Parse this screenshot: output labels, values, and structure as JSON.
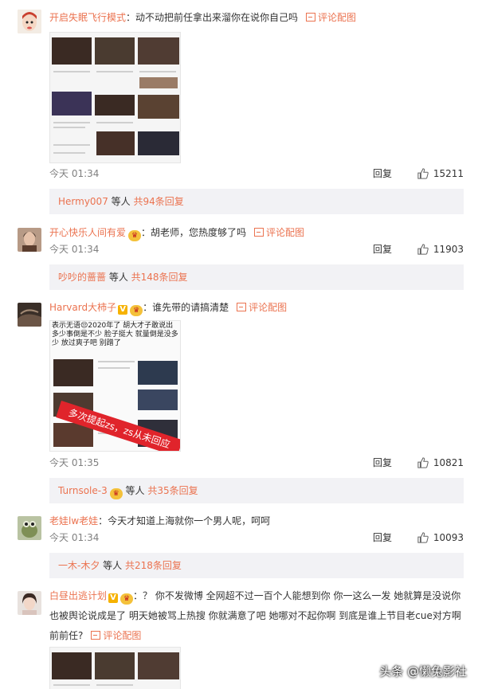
{
  "comments": [
    {
      "user": "开启失眠飞行模式",
      "text": "：动不动把前任拿出来溜你在说你自己吗",
      "pic_label": "评论配图",
      "time": "今天 01:34",
      "reply_label": "回复",
      "likes": "15211",
      "replies": {
        "user": "Hermy007",
        "middle": " 等人 ",
        "count": "共94条回复"
      }
    },
    {
      "user": "开心快乐人间有爱",
      "text": "：胡老师，您热度够了吗",
      "pic_label": "评论配图",
      "time": "今天 01:34",
      "reply_label": "回复",
      "likes": "11903",
      "replies": {
        "user": "吵吵的蔷蔷",
        "middle": " 等人 ",
        "count": "共148条回复"
      }
    },
    {
      "user": "Harvard大柿子",
      "text": "：谁先带的请搞清楚",
      "pic_label": "评论配图",
      "time": "今天 01:35",
      "reply_label": "回复",
      "likes": "10821",
      "image_text_top": "表示无语😒2020年了 胡大才子敢说出多少事倒是不少 脸子挺大 就量倒是没多少 放过爽子吧 别蹭了",
      "image_banner": "多次提起zs，zs从未回应",
      "replies": {
        "user": "Turnsole-3",
        "middle": " 等人 ",
        "count": "共35条回复"
      }
    },
    {
      "user": "老娃lw老娃",
      "text": "：今天才知道上海就你一个男人呢，呵呵",
      "time": "今天 01:34",
      "reply_label": "回复",
      "likes": "10093",
      "replies": {
        "user": "一木-木夕",
        "middle": " 等人 ",
        "count": "共218条回复"
      }
    },
    {
      "user": "白昼出逃计划",
      "text_line1": "：？ 你不发微博 全网超不过一百个人能想到你 你一这么一发 她就算是没说你",
      "text_line2": "也被舆论说成是了 明天她被骂上热搜 你就满意了吧 她哪对不起你啊 到底是谁上节目老cue对方啊",
      "text_line3": "前前任?",
      "pic_label": "评论配图"
    }
  ],
  "watermark": "头条 @懒兔影社",
  "colors": {
    "link": "#eb7350",
    "subbox": "#f2f2f5"
  },
  "icons": [
    "thumb-up-icon",
    "picture-icon",
    "verified-v-icon",
    "crown-badge-icon"
  ]
}
